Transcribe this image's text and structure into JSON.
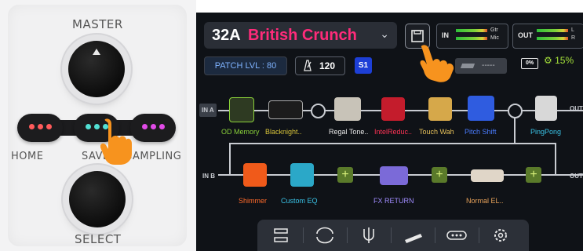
{
  "hardware": {
    "master_label": "MASTER",
    "select_label": "SELECT",
    "home_label": "HOME",
    "save_label": "SAVE",
    "sampling_label": "SAMPLING",
    "led_colors": {
      "home": "#ff5a5a",
      "save": "#52e0d4",
      "sampling": "#e24be8"
    }
  },
  "screen": {
    "patch": {
      "number": "32A",
      "name": "British Crunch"
    },
    "meters": {
      "in": {
        "label": "IN",
        "ch1": "Gtr",
        "ch2": "Mic"
      },
      "out": {
        "label": "OUT",
        "ch1": "L",
        "ch2": "R"
      }
    },
    "patch_level": "PATCH LVL : 80",
    "tempo": "120",
    "snapshot_button": "S1",
    "snapshot_placeholder": "-----",
    "battery": "0%",
    "cpu": "15%",
    "row_a": {
      "in_label": "IN A",
      "out_label": "OUT",
      "blocks": [
        {
          "label": "OD Memory",
          "color": "#8ad13a"
        },
        {
          "label": "Blacknight..",
          "color": "#d8c43a"
        },
        {
          "label": "Regal Tone..",
          "color": "#e8e8e8"
        },
        {
          "label": "IntelReduc..",
          "color": "#ff3355"
        },
        {
          "label": "Touch Wah",
          "color": "#e8c25a"
        },
        {
          "label": "Pitch Shift",
          "color": "#4a7cff"
        },
        {
          "label": "PingPong",
          "color": "#3ac4e8"
        }
      ]
    },
    "row_b": {
      "in_label": "IN B",
      "out_label": "OUT",
      "blocks": [
        {
          "label": "Shimmer",
          "color": "#ff6a2a"
        },
        {
          "label": "Custom EQ",
          "color": "#3ac4e8"
        },
        {
          "label": "FX RETURN",
          "color": "#a08cff"
        },
        {
          "label": "Normal EL..",
          "color": "#e8a25a"
        }
      ]
    },
    "tabs": [
      "routing-icon",
      "loop-icon",
      "tuner-icon",
      "expression-pedal-icon",
      "footswitch-icon",
      "settings-icon"
    ]
  }
}
